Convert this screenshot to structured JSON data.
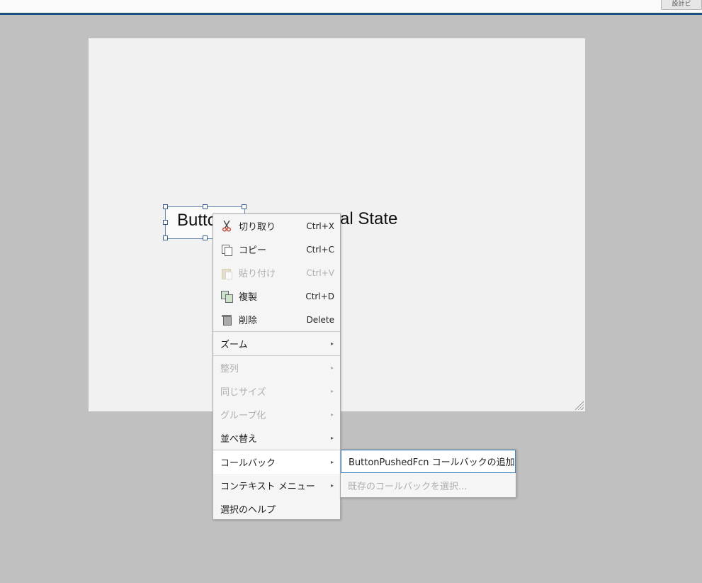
{
  "topbar": {
    "button_label": "設計ビ"
  },
  "canvas": {
    "button_text": "Button",
    "lamp_text": "al State"
  },
  "context_menu": {
    "items": [
      {
        "label": "切り取り",
        "shortcut": "Ctrl+X",
        "icon": "scissors-icon",
        "enabled": true
      },
      {
        "label": "コピー",
        "shortcut": "Ctrl+C",
        "icon": "copy-icon",
        "enabled": true
      },
      {
        "label": "貼り付け",
        "shortcut": "Ctrl+V",
        "icon": "paste-icon",
        "enabled": false
      },
      {
        "label": "複製",
        "shortcut": "Ctrl+D",
        "icon": "duplicate-icon",
        "enabled": true
      },
      {
        "label": "削除",
        "shortcut": "Delete",
        "icon": "trash-icon",
        "enabled": true
      },
      {
        "label": "ズーム",
        "submenu": true,
        "enabled": true
      },
      {
        "label": "整列",
        "submenu": true,
        "enabled": false
      },
      {
        "label": "同じサイズ",
        "submenu": true,
        "enabled": false
      },
      {
        "label": "グループ化",
        "submenu": true,
        "enabled": false
      },
      {
        "label": "並べ替え",
        "submenu": true,
        "enabled": true
      },
      {
        "label": "コールバック",
        "submenu": true,
        "enabled": true
      },
      {
        "label": "コンテキスト メニュー",
        "submenu": true,
        "enabled": true
      },
      {
        "label": "選択のヘルプ",
        "enabled": true
      }
    ]
  },
  "callback_submenu": {
    "items": [
      {
        "label": "ButtonPushedFcn コールバックの追加",
        "enabled": true
      },
      {
        "label": "既存のコールバックを選択...",
        "enabled": false
      }
    ]
  },
  "glyphs": {
    "submenu_arrow": "▸"
  }
}
